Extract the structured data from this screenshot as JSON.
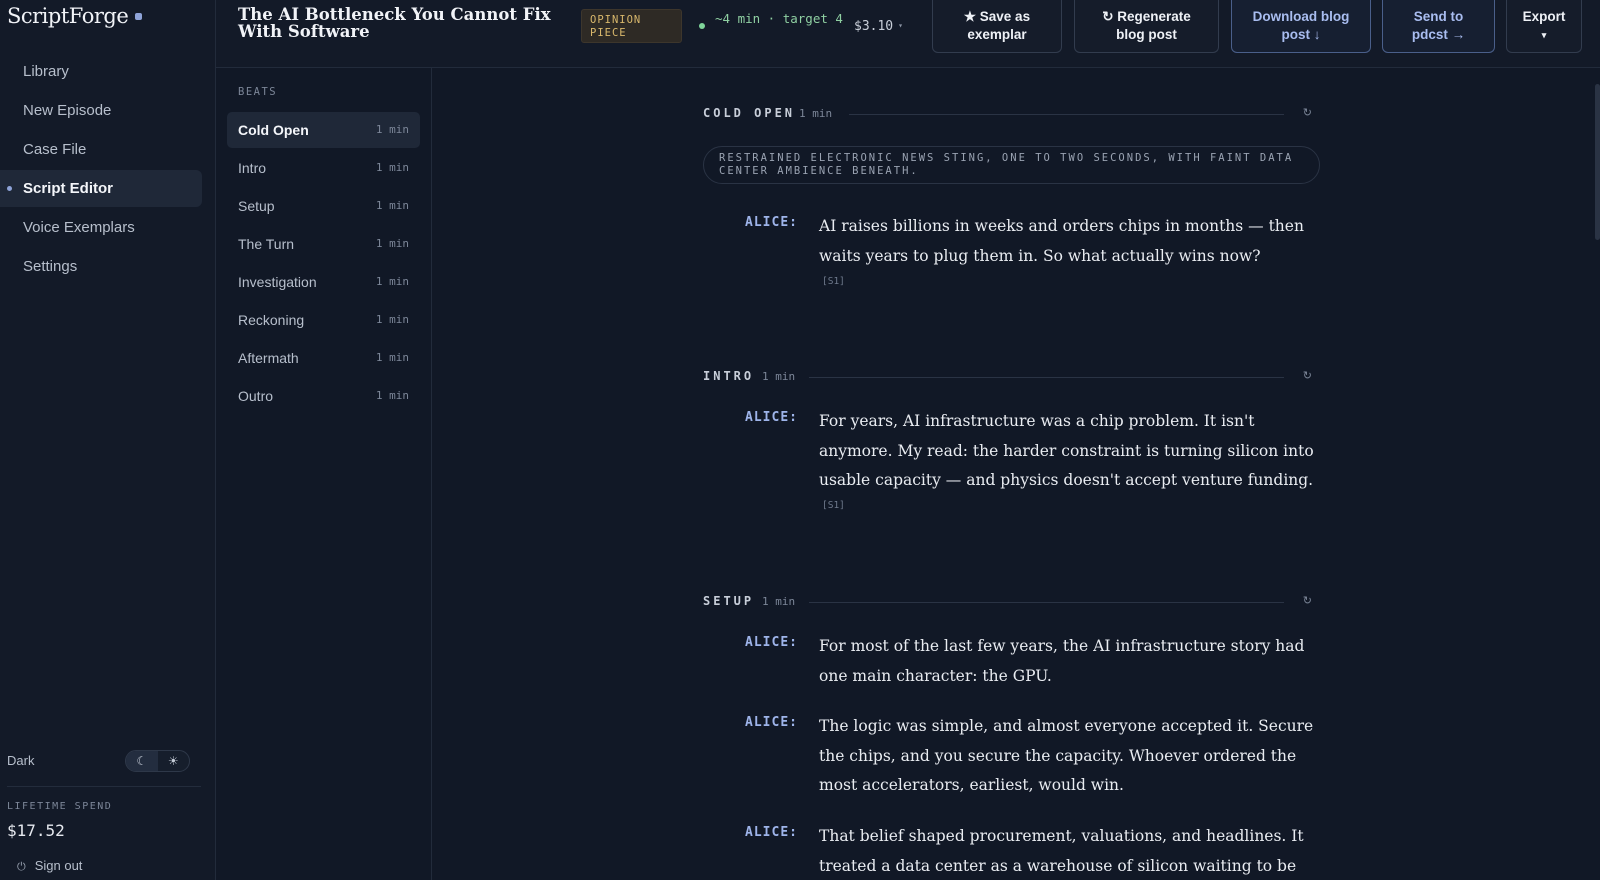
{
  "app": {
    "brand": "ScriptForge"
  },
  "nav": {
    "items": [
      "Library",
      "New Episode",
      "Case File",
      "Script Editor",
      "Voice Exemplars",
      "Settings"
    ],
    "active": "Script Editor"
  },
  "theme": {
    "label": "Dark",
    "moon": "☾",
    "sun": "☀",
    "mode": "dark"
  },
  "spend": {
    "label": "LIFETIME SPEND",
    "value": "$17.52"
  },
  "signout": {
    "label": "Sign out",
    "icon": "power-icon"
  },
  "header": {
    "title": "The AI Bottleneck You Cannot Fix With Software",
    "badge": "OPINION PIECE",
    "duration": "~4 min · target 4",
    "cost": "$3.10",
    "cost_caret": "▾",
    "buttons": {
      "save": "★ Save as exemplar",
      "regenerate": "↻ Regenerate blog post",
      "download": "Download blog post ↓",
      "send": "Send to pdcst →",
      "export": "Export",
      "export_caret": "▾"
    }
  },
  "beats": {
    "heading": "BEATS",
    "items": [
      {
        "label": "Cold Open",
        "dur": "1 min"
      },
      {
        "label": "Intro",
        "dur": "1 min"
      },
      {
        "label": "Setup",
        "dur": "1 min"
      },
      {
        "label": "The Turn",
        "dur": "1 min"
      },
      {
        "label": "Investigation",
        "dur": "1 min"
      },
      {
        "label": "Reckoning",
        "dur": "1 min"
      },
      {
        "label": "Aftermath",
        "dur": "1 min"
      },
      {
        "label": "Outro",
        "dur": "1 min"
      }
    ],
    "active": "Cold Open"
  },
  "script": {
    "regen_icon": "↻",
    "sections": {
      "cold_open": {
        "name": "COLD OPEN",
        "dur": "1 min",
        "direction": "Restrained electronic news sting, one to two seconds, with faint data center ambience beneath.",
        "lines": [
          {
            "speaker": "ALICE:",
            "text": "AI raises billions in weeks and orders chips in months — then waits years to plug them in. So what actually wins now?",
            "tag": "[S1]"
          }
        ]
      },
      "intro": {
        "name": "INTRO",
        "dur": "1 min",
        "lines": [
          {
            "speaker": "ALICE:",
            "text": "For years, AI infrastructure was a chip problem. It isn't anymore. My read: the harder constraint is turning silicon into usable capacity — and physics doesn't accept venture funding.",
            "tag": "[S1]"
          }
        ]
      },
      "setup": {
        "name": "SETUP",
        "dur": "1 min",
        "lines": [
          {
            "speaker": "ALICE:",
            "text": "For most of the last few years, the AI infrastructure story had one main character: the GPU."
          },
          {
            "speaker": "ALICE:",
            "text": "The logic was simple, and almost everyone accepted it. Secure the chips, and you secure the capacity. Whoever ordered the most accelerators, earliest, would win."
          },
          {
            "speaker": "ALICE:",
            "text": "That belief shaped procurement, valuations, and headlines. It treated a data center as a warehouse of silicon waiting to be filled."
          }
        ]
      }
    }
  }
}
